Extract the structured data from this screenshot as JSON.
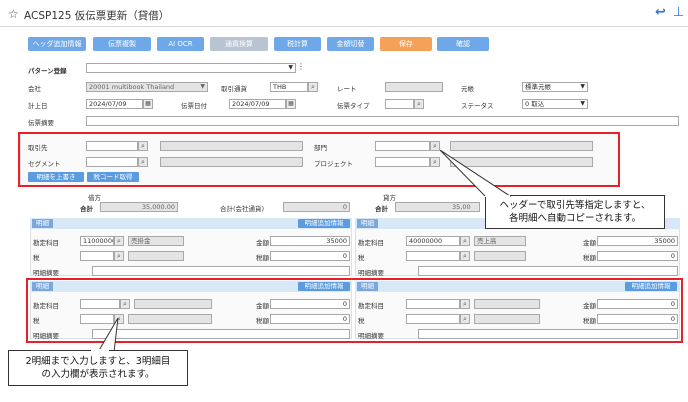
{
  "header": {
    "star_icon": "star-outline-icon",
    "title": "ACSP125 仮伝票更新（貸借）",
    "undo_icon": "undo-icon",
    "pin_icon": "pin-icon"
  },
  "toolbar": {
    "header_add": "ヘッダ追加情報",
    "voucher_copy": "伝票複製",
    "ai_ocr": "AI OCR",
    "currency_convert": "通貨換算",
    "tax_calc": "税計算",
    "amount_switch": "金額切替",
    "save": "保存",
    "confirm": "確認"
  },
  "form": {
    "pattern_label": "パターン登録",
    "company_label": "会社",
    "company_value": "20001 multibook Thailand",
    "currency_label": "取引通貨",
    "currency_value": "THB",
    "rate_label": "レート",
    "ledger_label": "元帳",
    "ledger_value": "標準元帳",
    "posting_date_label": "計上日",
    "posting_date_value": "2024/07/09",
    "voucher_date_label": "伝票日付",
    "voucher_date_value": "2024/07/09",
    "voucher_type_label": "伝票タイプ",
    "status_label": "ステータス",
    "status_value": "0 取込",
    "summary_label": "伝票摘要"
  },
  "common": {
    "partner_label": "取引先",
    "department_label": "部門",
    "segment_label": "セグメント",
    "project_label": "プロジェクト",
    "overwrite_btn": "明細を上書き",
    "tax_code_btn": "税コード取得"
  },
  "debit": {
    "side_label": "借方",
    "total_label": "合計",
    "total_value": "35,000.00",
    "total_company_label": "合計(会社通貨)",
    "total_company_value": "0"
  },
  "credit": {
    "side_label": "貸方",
    "total_label": "合計",
    "total_value": "35,00"
  },
  "detail": {
    "tag": "明細",
    "add_info_btn": "明細追加情報",
    "account_label": "勘定科目",
    "amount_label": "金額",
    "tax_label": "税",
    "tax_amount_label": "税額",
    "line_summary_label": "明細摘要"
  },
  "detail1_debit": {
    "account_code": "11000000",
    "account_name": "売掛金",
    "amount": "35000",
    "tax_amount": "0"
  },
  "detail1_credit": {
    "account_code": "40000000",
    "account_name": "売上高",
    "amount": "35000",
    "tax_amount": "0"
  },
  "detail2_debit": {
    "amount": "0",
    "tax_amount": "0"
  },
  "detail2_credit": {
    "amount": "0",
    "tax_amount": "0"
  },
  "callouts": {
    "right": "ヘッダーで取引先等指定しますと、\n各明細へ自動コピーされます。",
    "bottom": "2明細まで入力しますと、3明細目\nの入力欄が表示されます。"
  },
  "colors": {
    "accent": "#6fa8e8",
    "save": "#f4a259",
    "disabled_button": "#b9c4d2",
    "highlight": "#e8202a"
  }
}
